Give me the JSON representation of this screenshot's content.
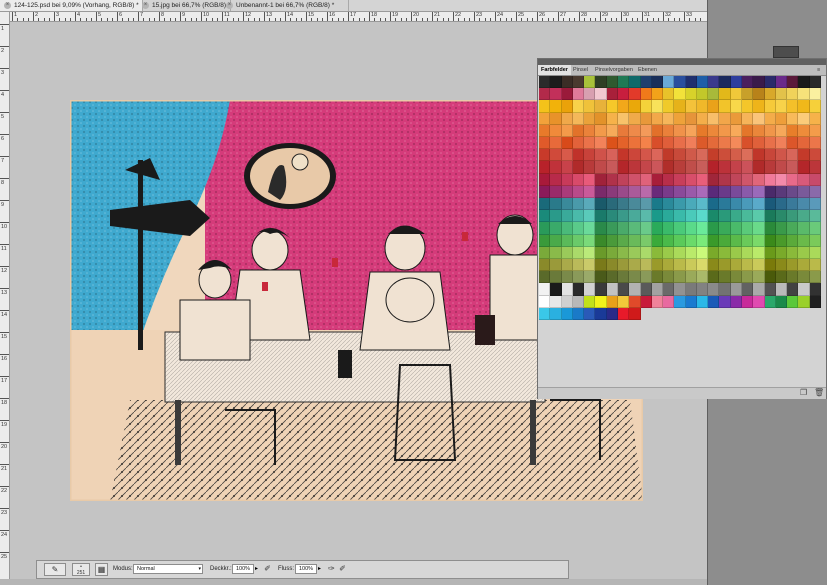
{
  "document_tabs": [
    {
      "label": "124-125.psd bei 9,09% (Vorhang, RGB/8) *",
      "active": true
    },
    {
      "label": "15.jpg bei 66,7% (RGB/8)",
      "active": false
    },
    {
      "label": "Unbenannt-1 bei 66,7% (RGB/8) *",
      "active": false
    }
  ],
  "ruler_top_numbers": [
    "1",
    "2",
    "3",
    "4",
    "5",
    "6",
    "7",
    "8",
    "9",
    "10",
    "11",
    "12",
    "13",
    "14",
    "15",
    "16",
    "17",
    "18",
    "19",
    "20",
    "21",
    "22",
    "23",
    "24",
    "25",
    "26",
    "27",
    "28",
    "29",
    "30",
    "31",
    "32",
    "33"
  ],
  "ruler_left_numbers": [
    "1",
    "2",
    "3",
    "4",
    "5",
    "6",
    "7",
    "8",
    "9",
    "10",
    "11",
    "12",
    "13",
    "14",
    "15",
    "16",
    "17",
    "18",
    "19",
    "20",
    "21",
    "22",
    "23",
    "24",
    "25"
  ],
  "panel": {
    "tabs": [
      {
        "label": "Farbfelder",
        "active": true
      },
      {
        "label": "Pinsel",
        "active": false
      },
      {
        "label": "Pinselvorgaben",
        "active": false
      },
      {
        "label": "Ebenen",
        "active": false
      }
    ],
    "swatch_rows": [
      [
        "#2b2b2b",
        "#1c1c1c",
        "#3a2d26",
        "#4a3a2f",
        "#a8c23a",
        "#2e3f24",
        "#2f5a2f",
        "#1f7a55",
        "#0f6a6a",
        "#1e3f6f",
        "#1a2f5a",
        "#6aa9d8",
        "#2a4f9e",
        "#1f2f6e",
        "#1e5ea8",
        "#3a3a8c",
        "#1b2a5e",
        "#2e3e9e",
        "#4a1f5e",
        "#3a1a4a",
        "#2a2a6a",
        "#6a2a8a",
        "#5a1a3a",
        "#1a1a1a",
        "#2a2a2a"
      ],
      [
        "#b22a4a",
        "#c2305a",
        "#9a1a3a",
        "#e07a9a",
        "#d8a0b0",
        "#f2c8d0",
        "#a8203a",
        "#c81e3e",
        "#e23a2a",
        "#f07a1a",
        "#f2a21a",
        "#e8c22a",
        "#f2e23a",
        "#d8d22a",
        "#c2c82a",
        "#a8ba3a",
        "#e2b81a",
        "#f0c83a",
        "#c8a02a",
        "#b8821a",
        "#d8a82a",
        "#e2c24a",
        "#f0d25a",
        "#f6e27a",
        "#faf0a0"
      ],
      [
        "#f4c21a",
        "#f2b20a",
        "#eaa20a",
        "#f8d24a",
        "#f0c23a",
        "#e8b23a",
        "#f6c82a",
        "#f2a81a",
        "#eaa80a",
        "#f4d23a",
        "#f8e25a",
        "#f0ca2a",
        "#e6b21a",
        "#f4c23a",
        "#f0b82a",
        "#eaa21a",
        "#f2c42a",
        "#f8d84a",
        "#f4c62a",
        "#eeb41a",
        "#f6ca3a",
        "#f8d24a",
        "#f4c02a",
        "#f0b81a",
        "#f6d03a"
      ],
      [
        "#f2a23a",
        "#e8922a",
        "#f0a84a",
        "#f4b85a",
        "#eaa23a",
        "#e2922a",
        "#f6b24a",
        "#f8c26a",
        "#f0aa4a",
        "#e8983a",
        "#f2a84a",
        "#f6b65a",
        "#eea23a",
        "#e6943a",
        "#f4ae4a",
        "#f8be6a",
        "#f2a64a",
        "#ea9a3a",
        "#f6b45a",
        "#fac47a",
        "#f4ac4a",
        "#ee9e3a",
        "#f8ba5a",
        "#fbcc7a",
        "#f6b24a"
      ],
      [
        "#e87a2a",
        "#f08a3a",
        "#f49a4a",
        "#e2722a",
        "#ea823a",
        "#f29a4a",
        "#f6aa5a",
        "#e87a3a",
        "#ee8a4a",
        "#f49a5a",
        "#e2702a",
        "#ea803a",
        "#f0924a",
        "#f6a45a",
        "#e67a2a",
        "#ec883a",
        "#f2984a",
        "#f8aa5a",
        "#e4762a",
        "#ea863a",
        "#f0964a",
        "#f6a85a",
        "#e87e2a",
        "#ee8c3a",
        "#f49c4a"
      ],
      [
        "#e05a2a",
        "#e86a3a",
        "#d84a1a",
        "#e2623a",
        "#ea724a",
        "#f2825a",
        "#dc521a",
        "#e4622a",
        "#ec723a",
        "#f4824a",
        "#d84e2a",
        "#e05e3a",
        "#e86e4a",
        "#f07e5a",
        "#dc5a2a",
        "#e46a3a",
        "#ec7a4a",
        "#f48a5a",
        "#d8502a",
        "#e0603a",
        "#e8704a",
        "#f0805a",
        "#dc562a",
        "#e4663a",
        "#ec764a"
      ],
      [
        "#c83a2a",
        "#d04a3a",
        "#d85a4a",
        "#c0322a",
        "#c8423a",
        "#d0524a",
        "#d8625a",
        "#c4362a",
        "#cc463a",
        "#d4564a",
        "#dc665a",
        "#c03a2a",
        "#c84a3a",
        "#d05a4a",
        "#d86a5a",
        "#c43e2a",
        "#cc4e3a",
        "#d45e4a",
        "#dc6e5a",
        "#c0362a",
        "#c8463a",
        "#d0564a",
        "#d8665a",
        "#c43a2a",
        "#cc4a3a"
      ],
      [
        "#b8222a",
        "#c0323a",
        "#c8424a",
        "#b02a2a",
        "#b83a3a",
        "#c04a4a",
        "#c85a5a",
        "#b4262a",
        "#bc363a",
        "#c4464a",
        "#cc565a",
        "#b02e2a",
        "#b83e3a",
        "#c04e4a",
        "#c85e5a",
        "#b4222a",
        "#bc323a",
        "#c4424a",
        "#cc525a",
        "#b02a2a",
        "#b83a3a",
        "#c04a4a",
        "#c85a5a",
        "#b4262a",
        "#bc363a"
      ],
      [
        "#a81a3a",
        "#b82a4a",
        "#c83a5a",
        "#d84a6a",
        "#e85a7a",
        "#a0223a",
        "#b0324a",
        "#c0425a",
        "#d0526a",
        "#e0627a",
        "#a81e3a",
        "#b82e4a",
        "#c83e5a",
        "#d84e6a",
        "#e85e7a",
        "#a0263a",
        "#b0364a",
        "#c0465a",
        "#d0566a",
        "#e0667a",
        "#f07a9a",
        "#f48aaa",
        "#e86a8a",
        "#d85a7a",
        "#c84a6a"
      ],
      [
        "#8a1a5a",
        "#9a2a6a",
        "#aa3a7a",
        "#ba4a8a",
        "#ca5a9a",
        "#7a2a6a",
        "#8a3a7a",
        "#9a4a8a",
        "#aa5a9a",
        "#ba6aaa",
        "#6a2a7a",
        "#7a3a8a",
        "#8a4a9a",
        "#9a5aaa",
        "#aa6aba",
        "#5a2a7a",
        "#6a3a8a",
        "#7a4a9a",
        "#8a5aaa",
        "#9a6aba",
        "#4a2a6a",
        "#5a3a7a",
        "#6a4a8a",
        "#7a5a9a",
        "#8a6aaa"
      ],
      [
        "#1a6a7a",
        "#2a7a8a",
        "#3a8a9a",
        "#4a9aaa",
        "#5aaaba",
        "#1a5a6a",
        "#2a6a7a",
        "#3a7a8a",
        "#4a8a9a",
        "#5a9aaa",
        "#1a7a8a",
        "#2a8a9a",
        "#3a9aaa",
        "#4aaaba",
        "#5abaca",
        "#1a6a8a",
        "#2a7a9a",
        "#3a8aaa",
        "#4a9aba",
        "#5aaaca",
        "#1a5a7a",
        "#2a6a8a",
        "#3a7a9a",
        "#4a8aaa",
        "#5a9aba"
      ],
      [
        "#1a8a7a",
        "#2a9a8a",
        "#3aaa9a",
        "#4abaaa",
        "#5acaba",
        "#1a7a6a",
        "#2a8a7a",
        "#3a9a8a",
        "#4aaa9a",
        "#5abaaa",
        "#1a9a8a",
        "#2aaa9a",
        "#3abaaa",
        "#4acaba",
        "#5adaca",
        "#1a8a6a",
        "#2a9a7a",
        "#3aaa8a",
        "#4aba9a",
        "#5acaaa",
        "#1a7a5a",
        "#2a8a6a",
        "#3a9a7a",
        "#4aaa8a",
        "#5aba9a"
      ],
      [
        "#2a9a5a",
        "#3aaa6a",
        "#4aba7a",
        "#5aca8a",
        "#6ada9a",
        "#2a8a4a",
        "#3a9a5a",
        "#4aaa6a",
        "#5aba7a",
        "#6aca8a",
        "#2aaa5a",
        "#3aba6a",
        "#4aca7a",
        "#5ada8a",
        "#6aea9a",
        "#2a9a4a",
        "#3aaa5a",
        "#4aba6a",
        "#5aca7a",
        "#6ada8a",
        "#2a8a3a",
        "#3a9a4a",
        "#4aaa5a",
        "#5aba6a",
        "#6aca7a"
      ],
      [
        "#3a9a3a",
        "#4aaa4a",
        "#5aba5a",
        "#6aca6a",
        "#7ada7a",
        "#3a8a2a",
        "#4a9a3a",
        "#5aaa4a",
        "#6aba5a",
        "#7aca6a",
        "#3aaa3a",
        "#4aba4a",
        "#5aca5a",
        "#6ada6a",
        "#7aea7a",
        "#3a9a2a",
        "#4aaa3a",
        "#5aba4a",
        "#6aca5a",
        "#7ada6a",
        "#3a8a1a",
        "#4a9a2a",
        "#5aaa3a",
        "#6aba4a",
        "#7aca5a"
      ],
      [
        "#7aaa3a",
        "#8aba4a",
        "#9aca5a",
        "#aada6a",
        "#baea7a",
        "#6a9a2a",
        "#7aaa3a",
        "#8aba4a",
        "#9aca5a",
        "#aada6a",
        "#8aba3a",
        "#9aca4a",
        "#aada5a",
        "#baea6a",
        "#cafa7a",
        "#7aaa2a",
        "#8aba3a",
        "#9aca4a",
        "#aada5a",
        "#baea6a",
        "#6a9a1a",
        "#7aaa2a",
        "#8aba3a",
        "#9aca4a",
        "#aada5a"
      ],
      [
        "#8a8a2a",
        "#9a9a3a",
        "#aaaa4a",
        "#baba5a",
        "#caca6a",
        "#7a7a1a",
        "#8a8a2a",
        "#9a9a3a",
        "#aaaa4a",
        "#baba5a",
        "#9a9a2a",
        "#aaaa3a",
        "#baba4a",
        "#caca5a",
        "#dada6a",
        "#8a8a1a",
        "#9a9a2a",
        "#aaaa3a",
        "#baba4a",
        "#caca5a",
        "#7a7a0a",
        "#8a8a1a",
        "#9a9a2a",
        "#aaaa3a",
        "#baba4a"
      ],
      [
        "#5a6a2a",
        "#6a7a3a",
        "#7a8a4a",
        "#8a9a5a",
        "#9aaa6a",
        "#4a5a1a",
        "#5a6a2a",
        "#6a7a3a",
        "#7a8a4a",
        "#8a9a5a",
        "#6a7a2a",
        "#7a8a3a",
        "#8a9a4a",
        "#9aaa5a",
        "#aaba6a",
        "#5a6a1a",
        "#6a7a2a",
        "#7a8a3a",
        "#8a9a4a",
        "#9aaa5a",
        "#4a5a0a",
        "#5a6a1a",
        "#6a7a2a",
        "#7a8a3a",
        "#8a9a4a"
      ],
      [
        "#f2f2f2",
        "#1a1a1a",
        "#e2e2e2",
        "#2a2a2a",
        "#d2d2d2",
        "#3a3a3a",
        "#c2c2c2",
        "#4a4a4a",
        "#b2b2b2",
        "#5a5a5a",
        "#a2a2a2",
        "#6a6a6a",
        "#929292",
        "#7a7a7a",
        "#828282",
        "#8a8a8a",
        "#727272",
        "#9a9a9a",
        "#626262",
        "#aaaaaa",
        "#525252",
        "#bababa",
        "#424242",
        "#cacaca",
        "#323232"
      ],
      [
        "#ffffff",
        "#e8e8e8",
        "#d0d0d0",
        "#b8b8b8",
        "#c2e01a",
        "#f2f21a",
        "#e8a01a",
        "#f2c83a",
        "#e04a2a",
        "#c81a3a",
        "#f0829a",
        "#e86aa0",
        "#2a9ae0",
        "#1a7ad0",
        "#2ab8e8",
        "#1a5ab8",
        "#6a3ab8",
        "#8a2aa8",
        "#c82a9a",
        "#e04ab0",
        "#2aa86a",
        "#1a8a4a",
        "#5ac83a",
        "#9ad02a",
        "#202020"
      ],
      [
        "#3ac8e8",
        "#2ab0e0",
        "#1a98d8",
        "#1a7ac8",
        "#2a5ab8",
        "#1a3a98",
        "#2a2a88",
        "#e81a2a",
        "#d01a1a"
      ]
    ],
    "swatch_cols": 25
  },
  "options_bar": {
    "tool_icon": "brush-icon",
    "brush_size": "251",
    "modus_label": "Modus:",
    "modus_value": "Normal",
    "deckkr_label": "Deckkr.:",
    "deckkr_value": "100%",
    "fluss_label": "Fluss:",
    "fluss_value": "100%"
  },
  "colors": {
    "canvas_bg": "#c4c4c4",
    "app_bg": "#8d8d8d",
    "curtain_blue": "#3fa9cf",
    "wall_pink": "#d53b7a",
    "paper": "#f0d7bd"
  }
}
